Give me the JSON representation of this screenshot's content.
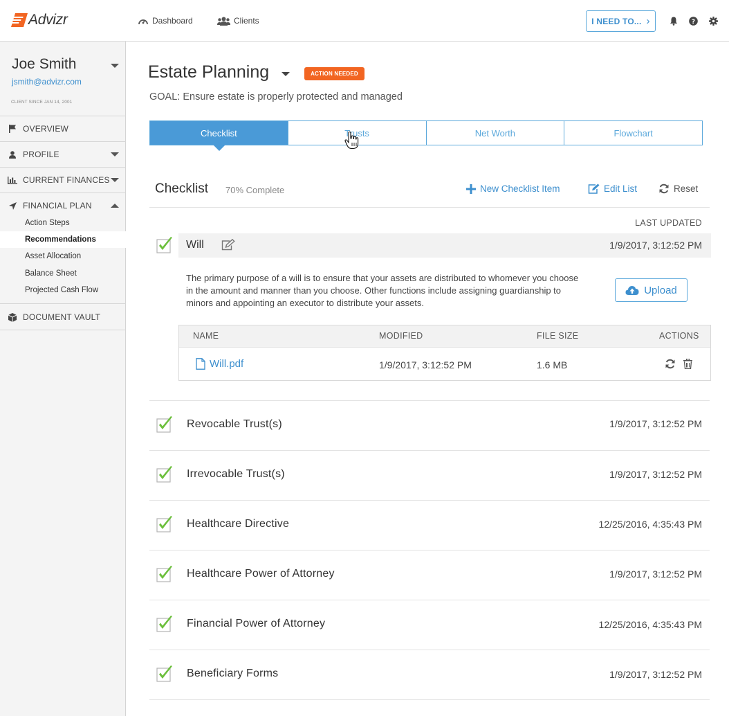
{
  "app": {
    "name": "Advizr"
  },
  "topnav": {
    "dashboard": "Dashboard",
    "clients": "Clients",
    "ineed_label": "I NEED TO...",
    "icons": [
      "bell-icon",
      "help-icon",
      "gear-icon"
    ]
  },
  "client": {
    "name": "Joe Smith",
    "email": "jsmith@advizr.com",
    "since": "CLIENT SINCE  JAN 14, 2001"
  },
  "sidebar": {
    "items": [
      {
        "label": "OVERVIEW",
        "icon": "flag-icon"
      },
      {
        "label": "PROFILE",
        "icon": "user-icon"
      },
      {
        "label": "CURRENT FINANCES",
        "icon": "bar-chart-icon"
      },
      {
        "label": "FINANCIAL PLAN",
        "icon": "location-arrow-icon"
      },
      {
        "label": "DOCUMENT VAULT",
        "icon": "cube-icon"
      }
    ],
    "sub_items": [
      {
        "label": "Action Steps",
        "active": false
      },
      {
        "label": "Recommendations",
        "active": true
      },
      {
        "label": "Asset Allocation",
        "active": false
      },
      {
        "label": "Balance Sheet",
        "active": false
      },
      {
        "label": "Projected Cash Flow",
        "active": false
      }
    ]
  },
  "main": {
    "title": "Estate Planning",
    "badge": "ACTION NEEDED",
    "goal": "GOAL:  Ensure estate is properly protected and managed",
    "tabs": [
      {
        "label": "Checklist",
        "active": true
      },
      {
        "label": "Trusts",
        "active": false
      },
      {
        "label": "Net Worth",
        "active": false
      },
      {
        "label": "Flowchart",
        "active": false
      }
    ]
  },
  "checklist": {
    "title": "Checklist",
    "progress": "70% Complete",
    "new_item": "New Checklist Item",
    "edit_list": "Edit List",
    "reset": "Reset",
    "last_updated_label": "LAST UPDATED",
    "expanded_item": {
      "name": "Will",
      "date": "1/9/2017, 3:12:52 PM",
      "description": "The primary purpose of a will is to ensure that your assets are distributed to whomever you choose in the amount and manner than you choose. Other functions include assigning guardianship to minors and appointing an executor to distribute your assets.",
      "upload_label": "Upload",
      "files_header": {
        "name": "NAME",
        "modified": "MODIFIED",
        "size": "FILE SIZE",
        "actions": "ACTIONS"
      },
      "files": [
        {
          "name": "Will.pdf",
          "modified": "1/9/2017, 3:12:52 PM",
          "size": "1.6 MB"
        }
      ]
    },
    "items": [
      {
        "name": "Revocable Trust(s)",
        "date": "1/9/2017, 3:12:52 PM"
      },
      {
        "name": "Irrevocable Trust(s)",
        "date": "1/9/2017, 3:12:52 PM"
      },
      {
        "name": "Healthcare Directive",
        "date": "12/25/2016, 4:35:43 PM"
      },
      {
        "name": "Healthcare Power of Attorney",
        "date": "1/9/2017, 3:12:52 PM"
      },
      {
        "name": "Financial Power of Attorney",
        "date": "12/25/2016, 4:35:43 PM"
      },
      {
        "name": "Beneficiary Forms",
        "date": "1/9/2017, 3:12:52 PM"
      }
    ]
  },
  "colors": {
    "accent": "#4a9ad7",
    "link": "#3d8fce",
    "badge": "#f26522",
    "check": "#6cbf3c"
  }
}
